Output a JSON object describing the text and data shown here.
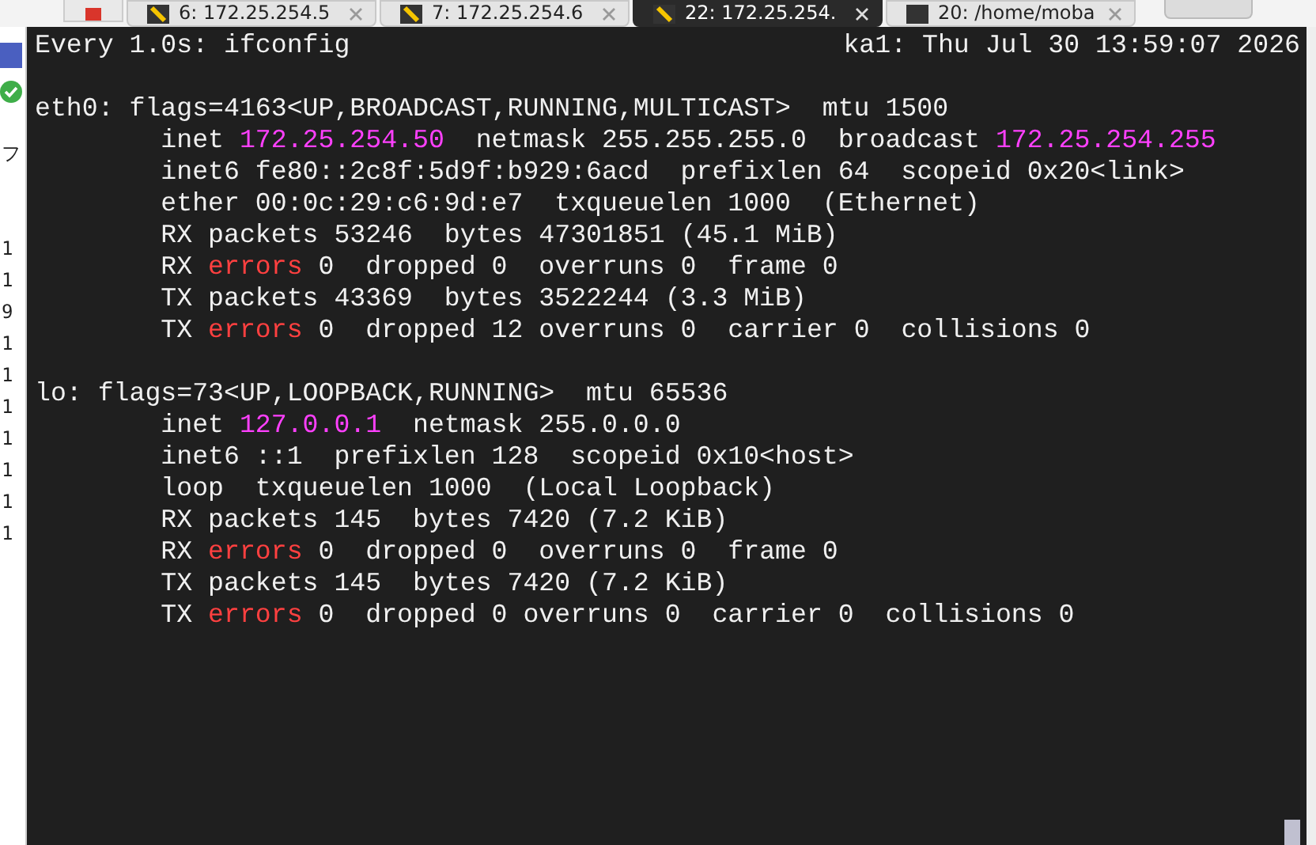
{
  "tabs": [
    {
      "label": "6: 172.25.254.5",
      "selected": false,
      "kind": "ssh"
    },
    {
      "label": "7: 172.25.254.6",
      "selected": false,
      "kind": "ssh"
    },
    {
      "label": "22: 172.25.254.",
      "selected": true,
      "kind": "ssh"
    },
    {
      "label": "20: /home/moba",
      "selected": false,
      "kind": "local"
    }
  ],
  "side_strip": {
    "items": [
      "フ",
      "1",
      "1",
      "9",
      "1",
      "1",
      "1",
      "1",
      "1",
      "1",
      "1"
    ]
  },
  "terminal": {
    "header": {
      "command": "Every 1.0s: ifconfig",
      "status": "ka1: Thu Jul 30 13:59:07 2026"
    },
    "interfaces": [
      {
        "lines": [
          [
            {
              "text": "eth0: flags=4163<UP,BROADCAST,RUNNING,MULTICAST>  mtu 1500",
              "kind": "plain"
            }
          ],
          [
            {
              "text": "        inet ",
              "kind": "plain"
            },
            {
              "text": "172.25.254.50",
              "kind": "address"
            },
            {
              "text": "  netmask 255.255.255.0  broadcast ",
              "kind": "plain"
            },
            {
              "text": "172.25.254.255",
              "kind": "address"
            }
          ],
          [
            {
              "text": "        inet6 fe80::2c8f:5d9f:b929:6acd  prefixlen 64  scopeid 0x20<link>",
              "kind": "plain"
            }
          ],
          [
            {
              "text": "        ether 00:0c:29:c6:9d:e7  txqueuelen 1000  (Ethernet)",
              "kind": "plain"
            }
          ],
          [
            {
              "text": "        RX packets 53246  bytes 47301851 (45.1 MiB)",
              "kind": "plain"
            }
          ],
          [
            {
              "text": "        RX ",
              "kind": "plain"
            },
            {
              "text": "errors",
              "kind": "error"
            },
            {
              "text": " 0  dropped 0  overruns 0  frame 0",
              "kind": "plain"
            }
          ],
          [
            {
              "text": "        TX packets 43369  bytes 3522244 (3.3 MiB)",
              "kind": "plain"
            }
          ],
          [
            {
              "text": "        TX ",
              "kind": "plain"
            },
            {
              "text": "errors",
              "kind": "error"
            },
            {
              "text": " 0  dropped 12 overruns 0  carrier 0  collisions 0",
              "kind": "plain"
            }
          ]
        ]
      },
      {
        "lines": [
          [
            {
              "text": "lo: flags=73<UP,LOOPBACK,RUNNING>  mtu 65536",
              "kind": "plain"
            }
          ],
          [
            {
              "text": "        inet ",
              "kind": "plain"
            },
            {
              "text": "127.0.0.1",
              "kind": "address"
            },
            {
              "text": "  netmask 255.0.0.0",
              "kind": "plain"
            }
          ],
          [
            {
              "text": "        inet6 ::1  prefixlen 128  scopeid 0x10<host>",
              "kind": "plain"
            }
          ],
          [
            {
              "text": "        loop  txqueuelen 1000  (Local Loopback)",
              "kind": "plain"
            }
          ],
          [
            {
              "text": "        RX packets 145  bytes 7420 (7.2 KiB)",
              "kind": "plain"
            }
          ],
          [
            {
              "text": "        RX ",
              "kind": "plain"
            },
            {
              "text": "errors",
              "kind": "error"
            },
            {
              "text": " 0  dropped 0  overruns 0  frame 0",
              "kind": "plain"
            }
          ],
          [
            {
              "text": "        TX packets 145  bytes 7420 (7.2 KiB)",
              "kind": "plain"
            }
          ],
          [
            {
              "text": "        TX ",
              "kind": "plain"
            },
            {
              "text": "errors",
              "kind": "error"
            },
            {
              "text": " 0  dropped 0 overruns 0  carrier 0  collisions 0",
              "kind": "plain"
            }
          ]
        ]
      }
    ]
  }
}
